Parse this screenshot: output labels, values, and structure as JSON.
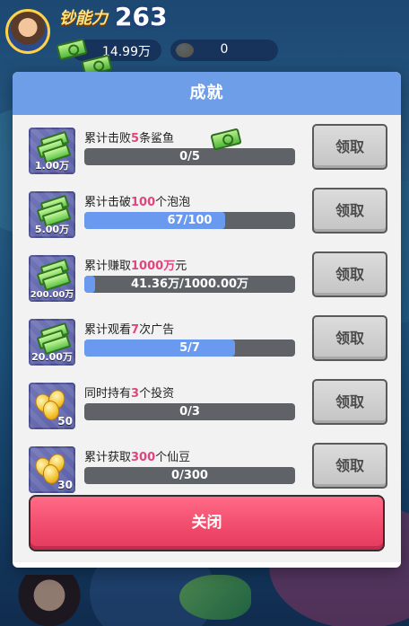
{
  "hud": {
    "power_label": "钞能力",
    "power_value": "263",
    "money": "14.99万",
    "beans": "0"
  },
  "modal": {
    "title": "成就",
    "close_label": "关闭",
    "claim_label": "领取",
    "rows": [
      {
        "icon": "cash-stack-icon",
        "reward": "1.00万",
        "title_pre": "累计击败",
        "title_hl": "5",
        "title_post": "条鲨鱼",
        "progress_text": "0/5",
        "progress": 0
      },
      {
        "icon": "cash-stack-icon",
        "reward": "5.00万",
        "title_pre": "累计击破",
        "title_hl": "100",
        "title_post": "个泡泡",
        "progress_text": "67/100",
        "progress": 0.67
      },
      {
        "icon": "cash-stack-icon",
        "reward": "200.00万",
        "title_pre": "累计赚取",
        "title_hl": "1000万",
        "title_post": "元",
        "progress_text": "41.36万/1000.00万",
        "progress": 0.0414
      },
      {
        "icon": "cash-stack-icon",
        "reward": "20.00万",
        "title_pre": "累计观看",
        "title_hl": "7",
        "title_post": "次广告",
        "progress_text": "5/7",
        "progress": 0.714
      },
      {
        "icon": "bean-icon",
        "reward": "50",
        "title_pre": "同时持有",
        "title_hl": "3",
        "title_post": "个投资",
        "progress_text": "0/3",
        "progress": 0
      },
      {
        "icon": "bean-icon",
        "reward": "30",
        "title_pre": "累计获取",
        "title_hl": "300",
        "title_post": "个仙豆",
        "progress_text": "0/300",
        "progress": 0
      }
    ]
  }
}
